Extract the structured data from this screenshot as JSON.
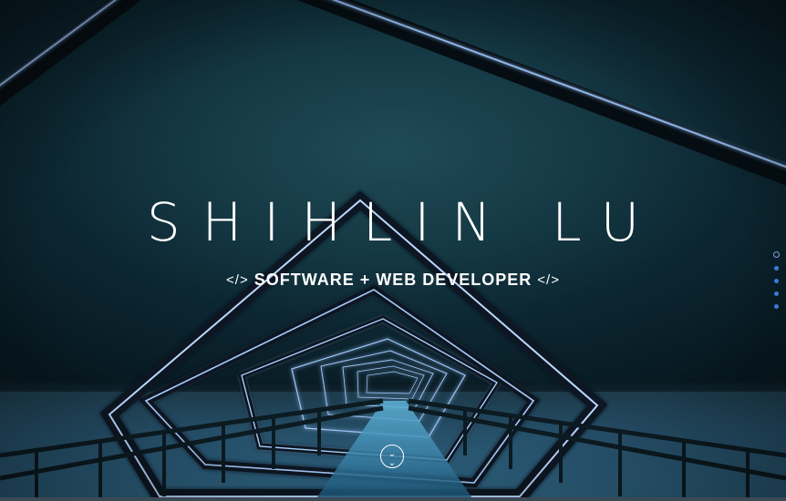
{
  "hero": {
    "title": "SHIHLIN LU",
    "subtitle": "SOFTWARE + WEB DEVELOPER",
    "code_icon_left": "</>",
    "code_icon_right": "</>"
  },
  "nav_dots": {
    "count": 5,
    "active_index": 0,
    "color": "#3b7bd9"
  },
  "scroll_button": {
    "icon": "double-chevron-down-icon",
    "glyph": "⌄⌄"
  },
  "colors": {
    "sky": "#153a45",
    "neon": "#8ab8ff",
    "text": "#ffffff"
  }
}
